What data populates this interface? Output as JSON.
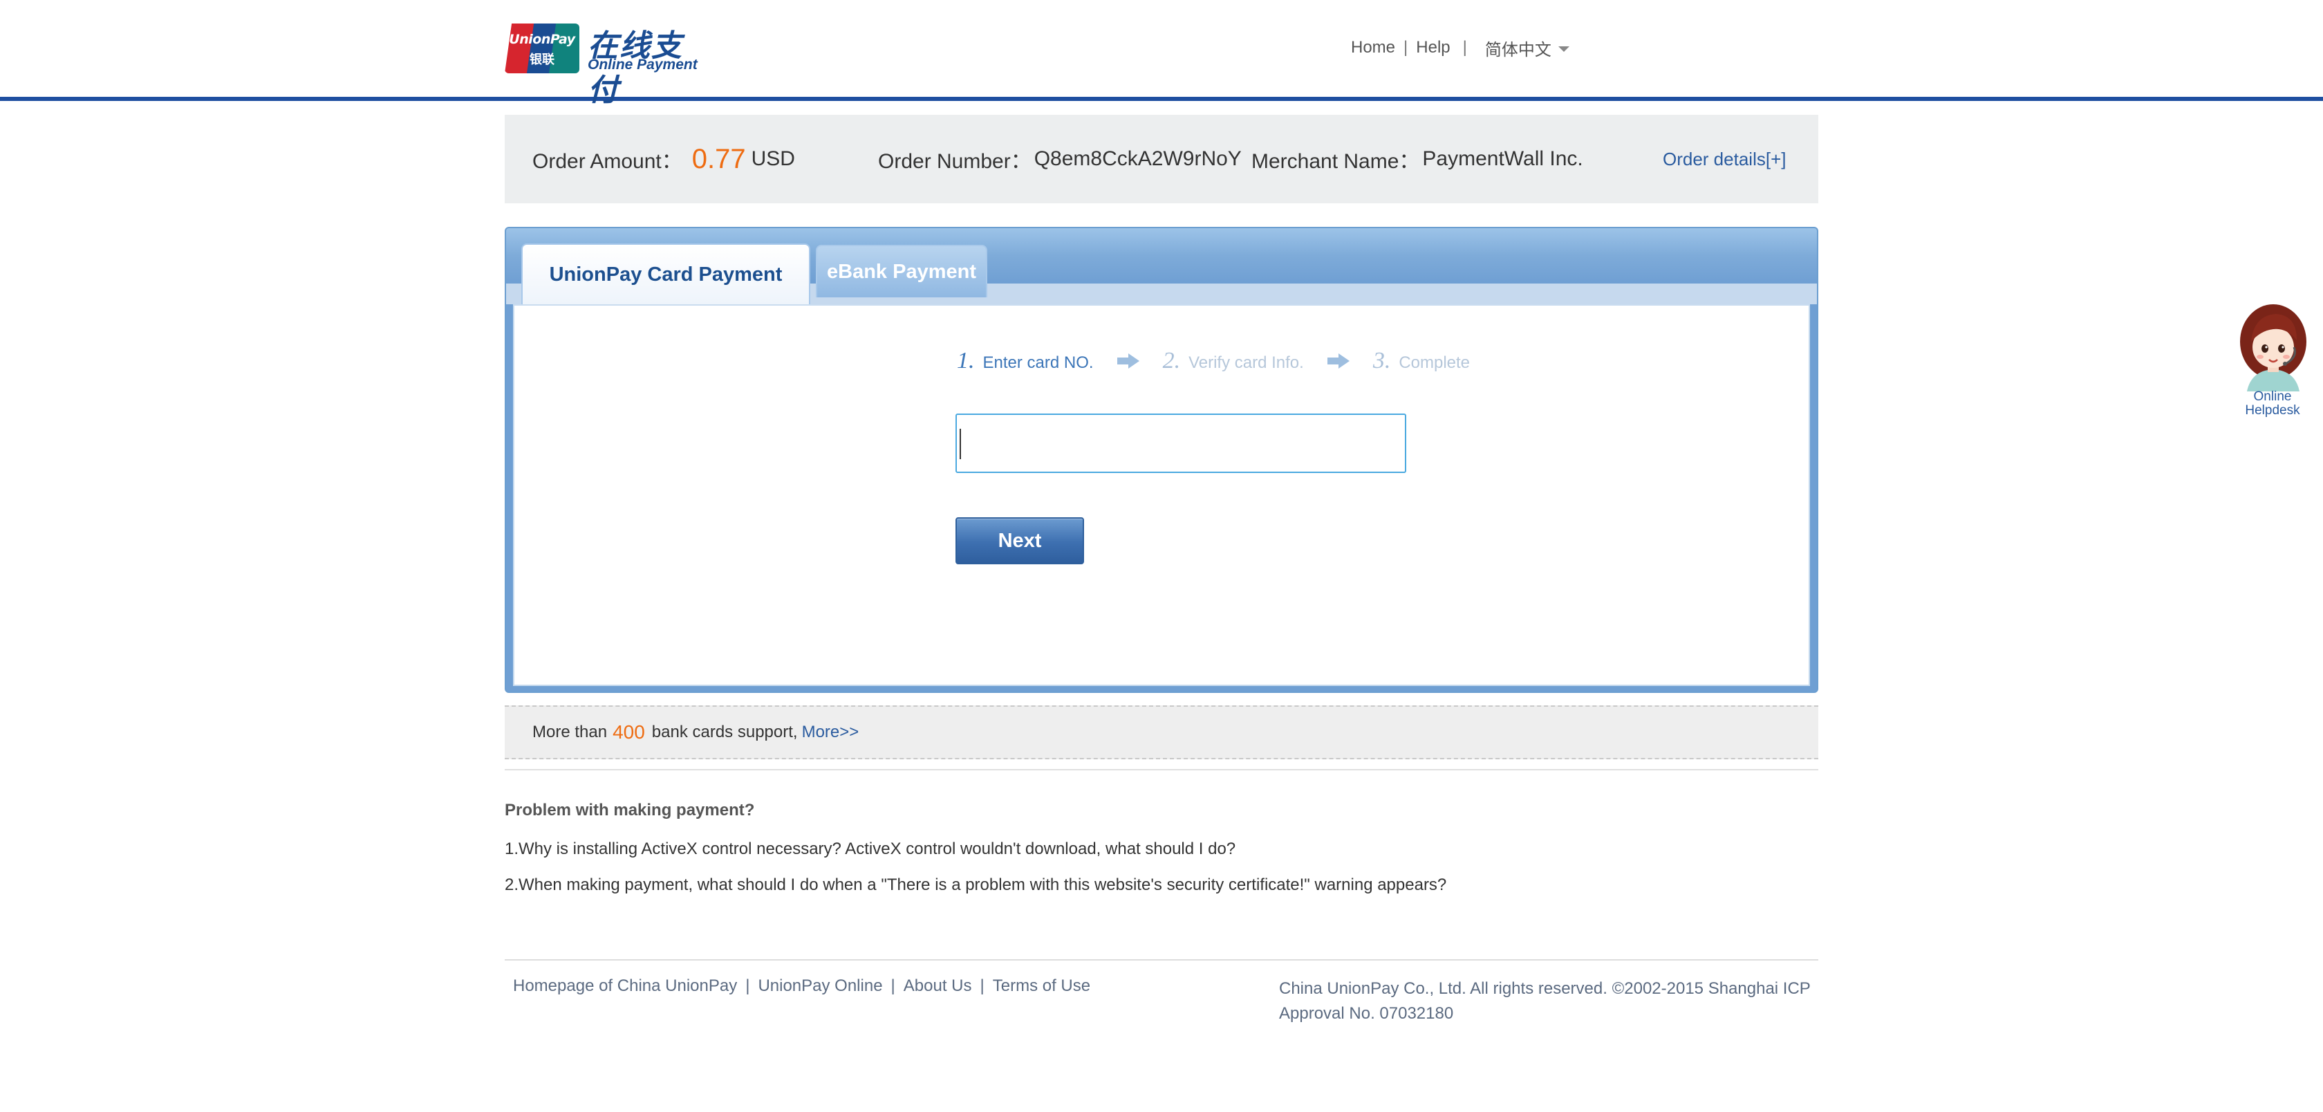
{
  "header": {
    "logo_card_text": "UnionPay",
    "logo_card_cn": "银联",
    "logo_title_cn": "在线支付",
    "logo_title_en": "Online Payment",
    "nav": {
      "home": "Home",
      "help": "Help",
      "separator": "|",
      "language": "简体中文"
    },
    "accent_color": "#1f4fa0"
  },
  "order": {
    "amount_label": "Order Amount：",
    "amount_value": "0.77",
    "currency": "USD",
    "number_label": "Order Number：",
    "number_value": "Q8em8CckA2W9rNoY",
    "merchant_label": "Merchant Name：",
    "merchant_value": "PaymentWall Inc.",
    "details_link": "Order details[+]",
    "amount_color": "#ee6c12"
  },
  "tabs": [
    {
      "label": "UnionPay Card Payment",
      "active": true
    },
    {
      "label": "eBank Payment",
      "active": false
    }
  ],
  "steps": [
    {
      "num": "1.",
      "label": "Enter card NO.",
      "active": true
    },
    {
      "num": "2.",
      "label": "Verify card Info.",
      "active": false
    },
    {
      "num": "3.",
      "label": "Complete",
      "active": false
    }
  ],
  "card_input": {
    "value": "",
    "placeholder": ""
  },
  "next_button": "Next",
  "banks": {
    "prefix": "More than",
    "count": "400",
    "suffix": "bank cards support,",
    "more_link": "More>>"
  },
  "faq": {
    "title": "Problem with making payment?",
    "items": [
      "1.Why is installing ActiveX control necessary? ActiveX control wouldn't download, what should I do?",
      "2.When making payment, what should I do when a \"There is a problem with this website's security certificate!\" warning appears?"
    ]
  },
  "footer": {
    "links": [
      "Homepage of China UnionPay",
      "UnionPay Online",
      "About Us",
      "Terms of Use"
    ],
    "separator": "|",
    "copyright": "China UnionPay Co., Ltd. All rights reserved. ©2002-2015 Shanghai ICP Approval No. 07032180"
  },
  "helpdesk": {
    "line1": "Online",
    "line2": "Helpdesk",
    "icon": "helpdesk-avatar-icon"
  }
}
